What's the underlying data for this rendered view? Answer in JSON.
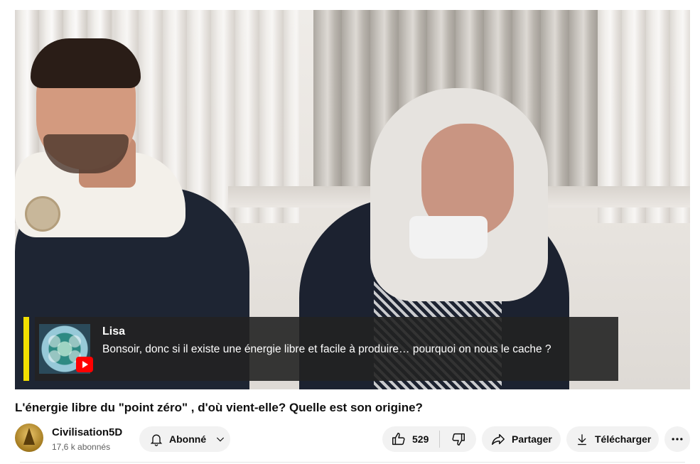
{
  "player": {
    "chat": {
      "author": "Lisa",
      "message": "Bonsoir, donc si il existe une énergie libre et facile à produire… pourquoi on nous le cache ?",
      "accent_color": "#f2df00",
      "source_icon": "youtube-icon"
    }
  },
  "video": {
    "title": "L'énergie libre du \"point zéro\" , d'où vient-elle? Quelle est son origine?"
  },
  "channel": {
    "name": "Civilisation5D",
    "subscribers": "17,6 k abonnés",
    "subscribe_label": "Abonné"
  },
  "actions": {
    "like_count": "529",
    "share_label": "Partager",
    "download_label": "Télécharger"
  },
  "icons": {
    "bell": "bell-icon",
    "chevron": "chevron-down-icon",
    "like": "thumbs-up-icon",
    "dislike": "thumbs-down-icon",
    "share": "share-icon",
    "download": "download-icon",
    "more": "more-icon"
  }
}
